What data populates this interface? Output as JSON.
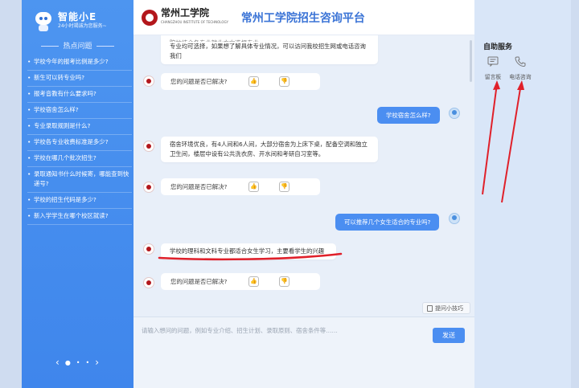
{
  "sidebar": {
    "brand_name": "智能小E",
    "brand_sub": "24小时竭诚为您服务~",
    "hot_title": "热点问题",
    "questions": [
      "学校今年的报考比例是多少?",
      "新生可以转专业吗?",
      "报考音教有什么要求吗?",
      "学校宿舍怎么样?",
      "专业录取规则是什么?",
      "学校各专业收费标准是多少?",
      "学校在哪几个批次招生?",
      "录取通知书什么时候寄，哪能查到快递号?",
      "学校的招生代码是多少?",
      "新入学学生在哪个校区就读?"
    ],
    "pager_prev": "‹",
    "pager_next": "›"
  },
  "header": {
    "school_name": "常州工学院",
    "school_name_en": "CHANGZHOU INSTITUTE OF TECHNOLOGY",
    "title": "常州工学院招生咨询平台"
  },
  "chat": {
    "first_answer": "专业均可选择，如果想了解具体专业情况，可以访问我校招生网或电话咨询我们",
    "first_answer_top": "院校结合各专业就业方向选报专业...",
    "feedback_q": "您的问题是否已解决?",
    "thumb_up": "👍",
    "thumb_down": "👎",
    "user_q1": "学校宿舍怎么样?",
    "dorm_answer": "宿舍环境优良，有4人间和6人间，大部分宿舍为上床下桌，配备空调和独立卫生间，楼层中设有公共洗衣房、开水间和考研自习室等。",
    "user_q2": "可以推荐几个女生适合的专业吗?",
    "major_answer": "学校的理科和文科专业都适合女生学习，主要看学生的兴趣",
    "tips_button": "提问小技巧"
  },
  "input": {
    "placeholder": "请输入想问的问题，例如专业介绍、招生计划、录取原则、宿舍条件等……",
    "send_label": "发送"
  },
  "right_panel": {
    "title": "自助服务",
    "services": [
      {
        "label": "留言板",
        "icon": "message-board-icon"
      },
      {
        "label": "电话咨询",
        "icon": "phone-icon"
      }
    ]
  },
  "colors": {
    "accent": "#4b8ef1",
    "sidebar": "#4d95f0",
    "annotation": "#e0202a"
  }
}
